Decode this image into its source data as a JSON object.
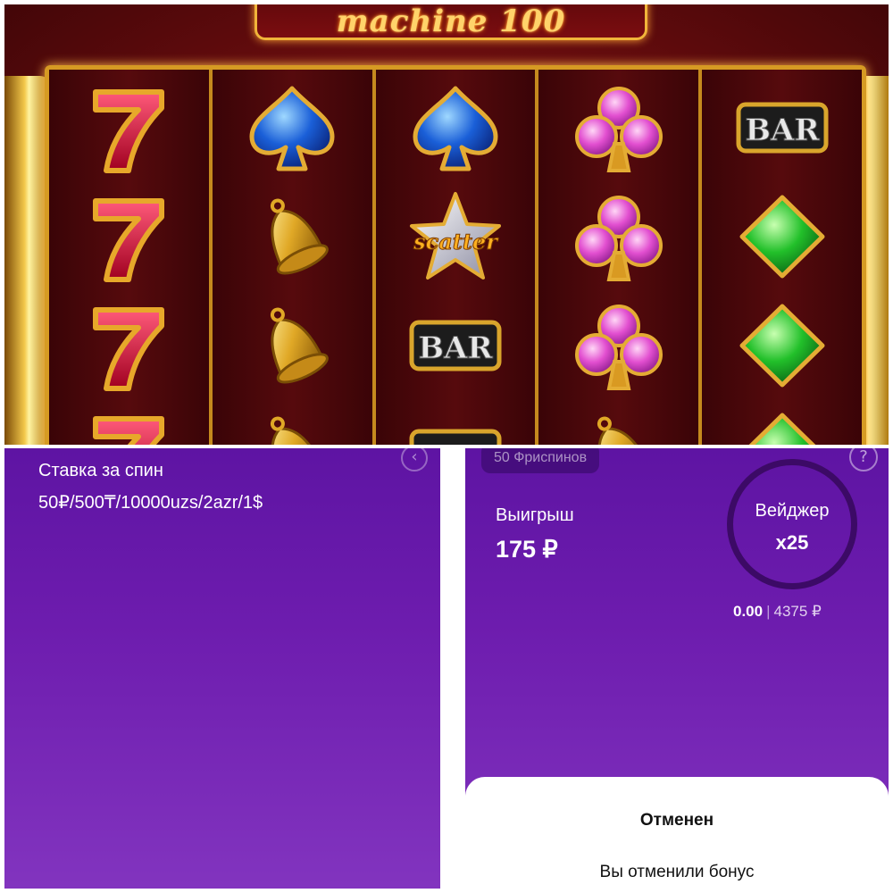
{
  "slot": {
    "logo_text": "machine 100",
    "reels": [
      [
        "seven",
        "seven",
        "seven",
        "seven"
      ],
      [
        "spade",
        "bell",
        "bell",
        "bell"
      ],
      [
        "spade",
        "scatter",
        "bar",
        "bar"
      ],
      [
        "club",
        "club",
        "club",
        "bell"
      ],
      [
        "bar",
        "diamond",
        "diamond",
        "diamond"
      ]
    ],
    "symbol_texts": {
      "bar": "BAR",
      "scatter": "scatter",
      "seven": "7"
    }
  },
  "left_panel": {
    "bet_label": "Ставка за спин",
    "bet_value": "50₽/500₸/10000uzs/2azr/1$",
    "back_icon": "chevron-left-icon"
  },
  "right_panel": {
    "freespins": "50 Фриспинов",
    "help_icon": "question-icon",
    "win_label": "Выигрыш",
    "win_value": "175 ₽",
    "wager_label": "Вейджер",
    "wager_value": "x25",
    "wager_current": "0.00",
    "wager_separator": "|",
    "wager_total": "4375 ₽",
    "sheet_title": "Отменен",
    "sheet_text": "Вы отменили бонус"
  },
  "colors": {
    "panel_purple": "#6d1cae",
    "slot_red": "#5c0a0c",
    "gold": "#d69a23"
  }
}
